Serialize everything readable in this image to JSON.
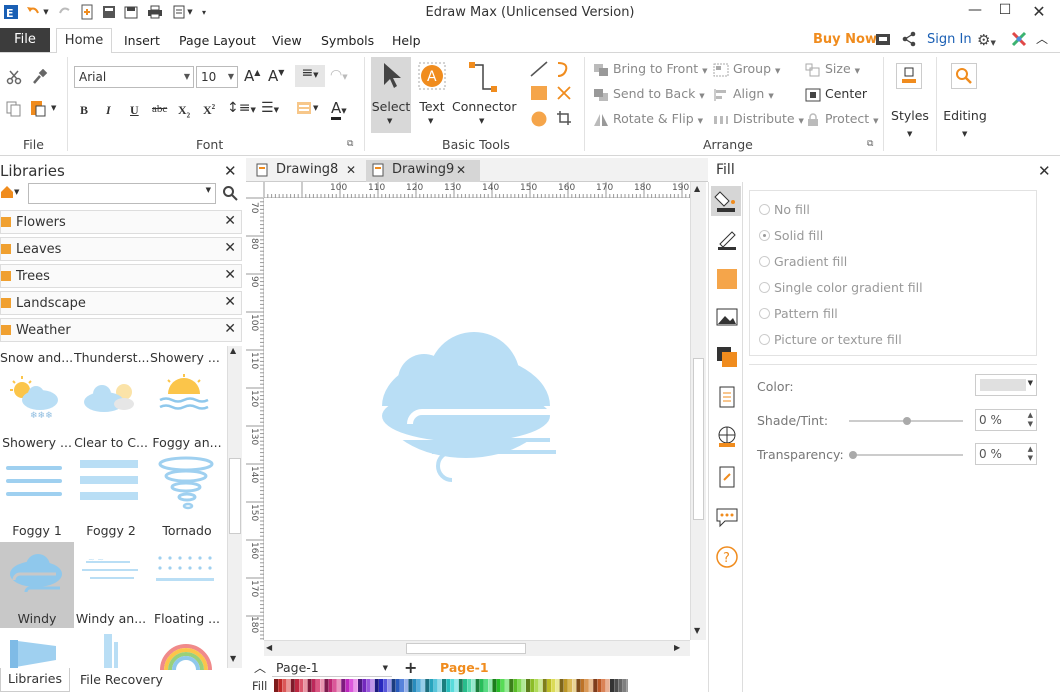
{
  "app": {
    "title": "Edraw Max (Unlicensed Version)"
  },
  "header_right": {
    "buy_now": "Buy Now",
    "sign_in": "Sign In"
  },
  "tabs": {
    "file": "File",
    "home": "Home",
    "insert": "Insert",
    "page_layout": "Page Layout",
    "view": "View",
    "symbols": "Symbols",
    "help": "Help"
  },
  "ribbon": {
    "groups": {
      "file": "File",
      "font": "Font",
      "basic_tools": "Basic Tools",
      "arrange": "Arrange",
      "styles": "Styles",
      "editing": "Editing"
    },
    "font_name": "Arial",
    "font_size": "10",
    "tools": {
      "select": "Select",
      "text": "Text",
      "connector": "Connector"
    },
    "arrange": {
      "bring_to_front": "Bring to Front",
      "send_to_back": "Send to Back",
      "rotate_flip": "Rotate & Flip",
      "group": "Group",
      "align": "Align",
      "distribute": "Distribute",
      "size": "Size",
      "center": "Center",
      "protect": "Protect"
    }
  },
  "libraries": {
    "title": "Libraries",
    "categories": [
      "Flowers",
      "Leaves",
      "Trees",
      "Landscape",
      "Weather"
    ],
    "top_row": [
      "Snow and...",
      "Thunderst...",
      "Showery ..."
    ],
    "shapes": [
      "Showery ...",
      "Clear to C...",
      "Foggy an...",
      "Foggy 1",
      "Foggy 2",
      "Tornado",
      "Windy",
      "Windy an...",
      "Floating ..."
    ],
    "selected": "Windy"
  },
  "bottom_tabs": {
    "libraries": "Libraries",
    "file_recovery": "File Recovery"
  },
  "documents": {
    "tabs": [
      "Drawing8",
      "Drawing9"
    ],
    "active": "Drawing9"
  },
  "ruler": {
    "h_ticks": [
      "100",
      "110",
      "120",
      "130",
      "140",
      "150",
      "160",
      "170",
      "180",
      "190",
      "200"
    ],
    "v_ticks": [
      "70",
      "80",
      "90",
      "100",
      "110",
      "120",
      "130",
      "140",
      "150",
      "160",
      "170",
      "180"
    ]
  },
  "pages": {
    "current": "Page-1",
    "tab": "Page-1"
  },
  "colorbar_label": "Fill",
  "fill": {
    "title": "Fill",
    "options": [
      "No fill",
      "Solid fill",
      "Gradient fill",
      "Single color gradient fill",
      "Pattern fill",
      "Picture or texture fill"
    ],
    "selected": "Solid fill",
    "color_label": "Color:",
    "shade_label": "Shade/Tint:",
    "shade_value": "0 %",
    "transparency_label": "Transparency:",
    "transparency_value": "0 %"
  },
  "colors": {
    "accent": "#f08c1e",
    "cloud": "#b9def5",
    "link": "#1a5fb4",
    "dark": "#3c3c3c"
  }
}
